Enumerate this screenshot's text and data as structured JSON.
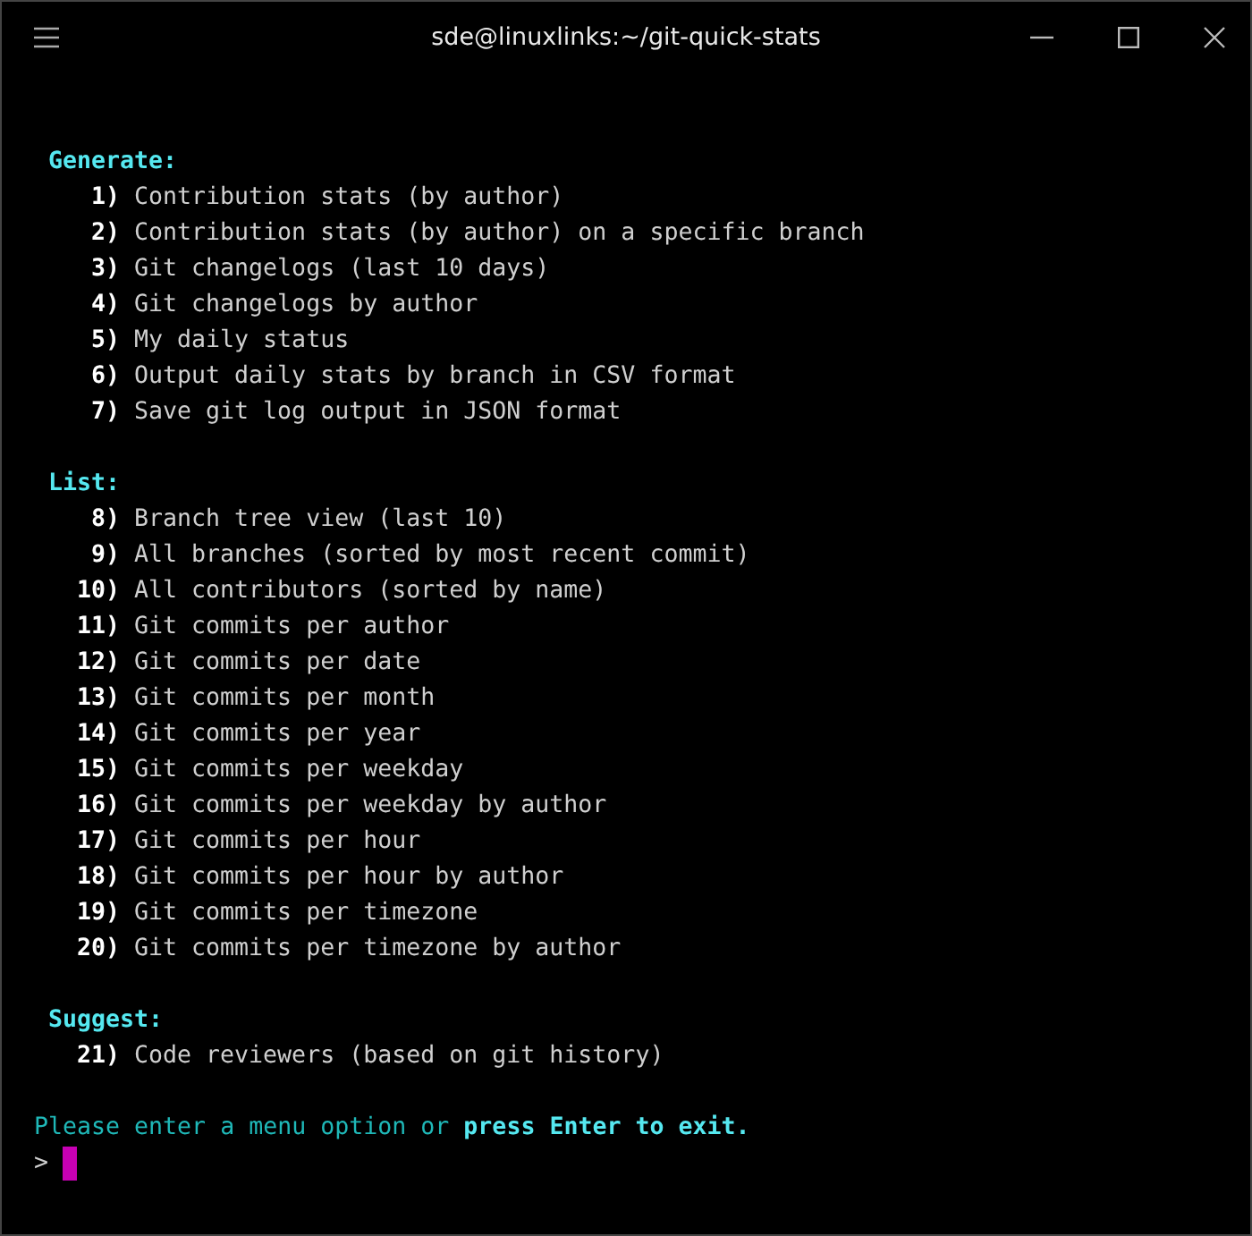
{
  "window": {
    "title": "sde@linuxlinks:~/git-quick-stats"
  },
  "sections": [
    {
      "heading": "Generate:",
      "items": [
        {
          "number": "1)",
          "label": "Contribution stats (by author)"
        },
        {
          "number": "2)",
          "label": "Contribution stats (by author) on a specific branch"
        },
        {
          "number": "3)",
          "label": "Git changelogs (last 10 days)"
        },
        {
          "number": "4)",
          "label": "Git changelogs by author"
        },
        {
          "number": "5)",
          "label": "My daily status"
        },
        {
          "number": "6)",
          "label": "Output daily stats by branch in CSV format"
        },
        {
          "number": "7)",
          "label": "Save git log output in JSON format"
        }
      ]
    },
    {
      "heading": "List:",
      "items": [
        {
          "number": "8)",
          "label": "Branch tree view (last 10)"
        },
        {
          "number": "9)",
          "label": "All branches (sorted by most recent commit)"
        },
        {
          "number": "10)",
          "label": "All contributors (sorted by name)"
        },
        {
          "number": "11)",
          "label": "Git commits per author"
        },
        {
          "number": "12)",
          "label": "Git commits per date"
        },
        {
          "number": "13)",
          "label": "Git commits per month"
        },
        {
          "number": "14)",
          "label": "Git commits per year"
        },
        {
          "number": "15)",
          "label": "Git commits per weekday"
        },
        {
          "number": "16)",
          "label": "Git commits per weekday by author"
        },
        {
          "number": "17)",
          "label": "Git commits per hour"
        },
        {
          "number": "18)",
          "label": "Git commits per hour by author"
        },
        {
          "number": "19)",
          "label": "Git commits per timezone"
        },
        {
          "number": "20)",
          "label": "Git commits per timezone by author"
        }
      ]
    },
    {
      "heading": "Suggest:",
      "items": [
        {
          "number": "21)",
          "label": "Code reviewers (based on git history)"
        }
      ]
    }
  ],
  "message": "Please enter a menu option or **press Enter to exit.**",
  "prompt": ">"
}
